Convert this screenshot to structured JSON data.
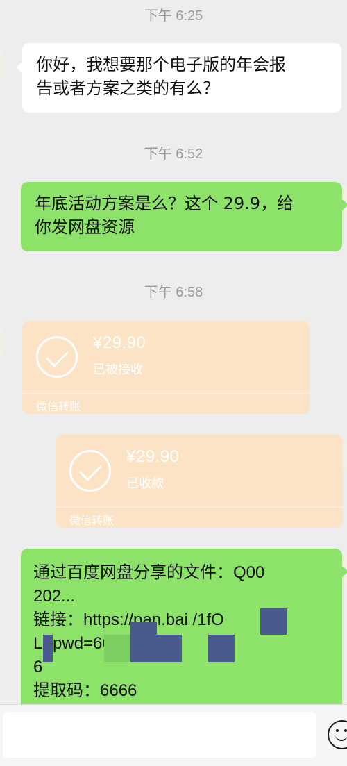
{
  "timestamps": [
    "下午 6:25",
    "下午 6:52",
    "下午 6:58"
  ],
  "messages": [
    {
      "sender": "contact",
      "lines": [
        "你好，我想要那个电子版的年会报",
        "告或者方案之类的有么？"
      ]
    },
    {
      "sender": "me",
      "lines": [
        "年底活动方案是么？这个 29.9，给",
        "你发网盘资源"
      ]
    },
    {
      "sender": "me",
      "lines": [
        "通过百度网盘分享的文件：Q00",
        "202...",
        "链接：https://pan.bai        /1fO",
        "Lr                       pwd=66",
        "6",
        "提取码：6666"
      ]
    }
  ],
  "transfers": [
    {
      "sender": "contact",
      "amount": "¥29.90",
      "status": "已被接收",
      "footer": "微信转账"
    },
    {
      "sender": "me",
      "amount": "¥29.90",
      "status": "已收款",
      "footer": "微信转账"
    }
  ],
  "colors": {
    "background": "#ededed",
    "outgoing_bubble": "#8de26a",
    "incoming_bubble": "#ffffff",
    "transfer_card": "#fce3c5",
    "mosaic_blue": "#4a5a8c",
    "mosaic_green": "#7ecf62"
  },
  "input_bar": {
    "emoji_icon": "emoji-face-icon"
  }
}
